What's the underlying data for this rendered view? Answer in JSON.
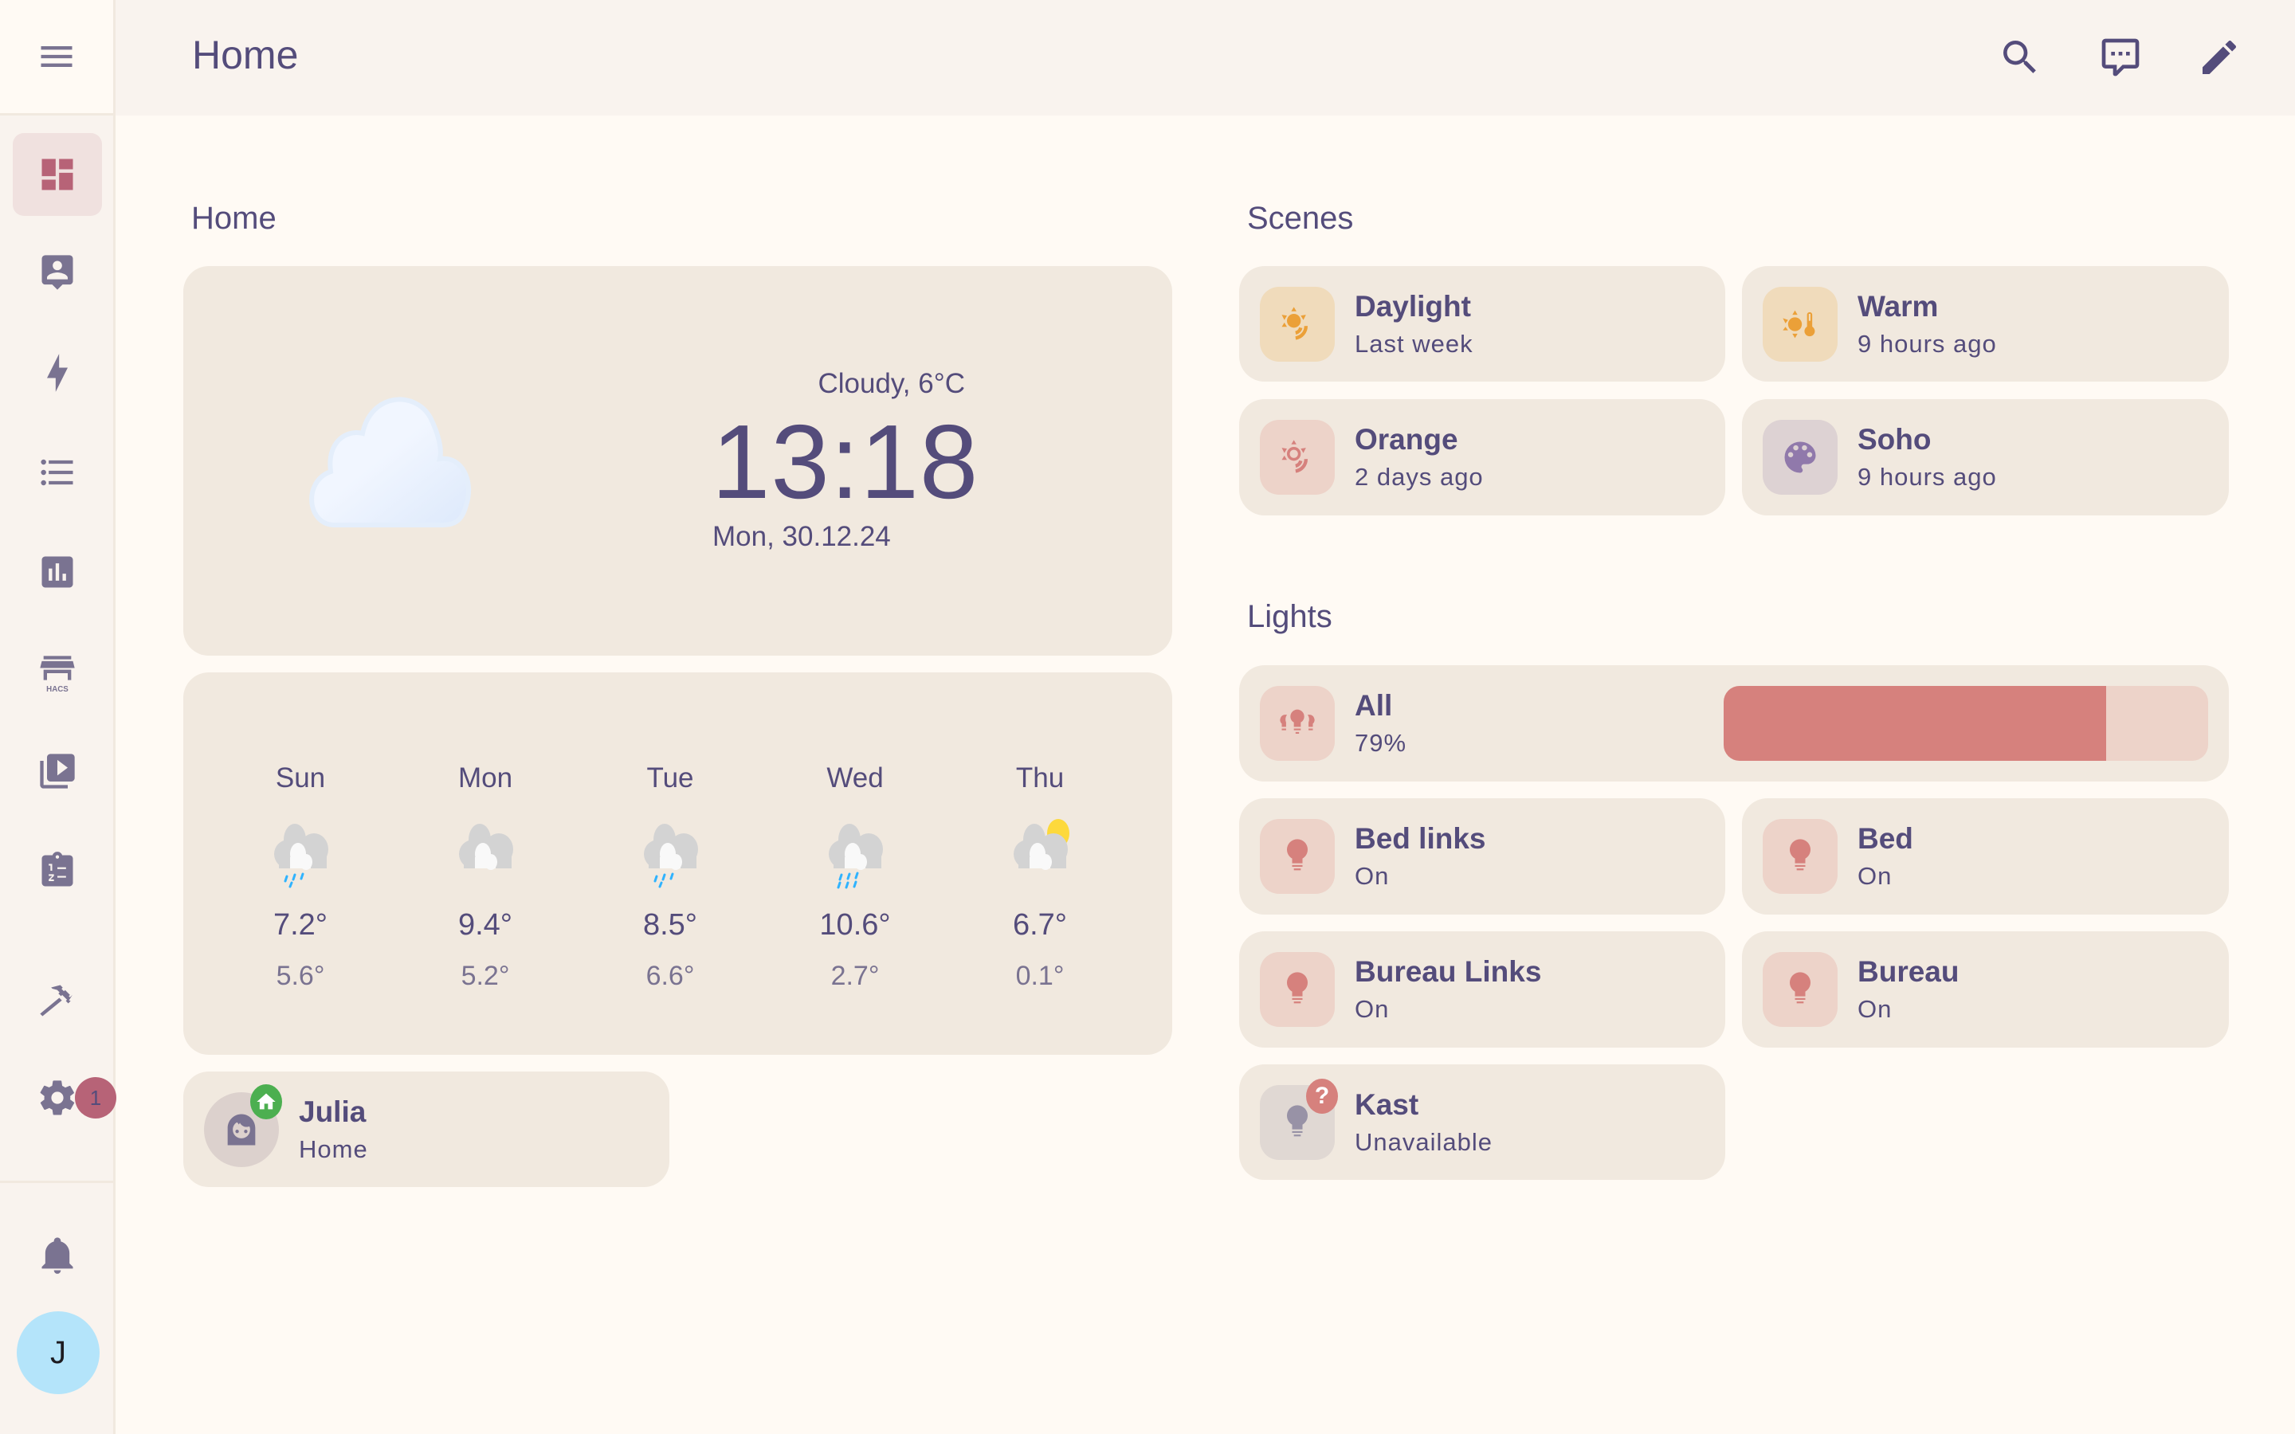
{
  "header": {
    "title": "Home",
    "actions": [
      {
        "name": "search",
        "icon": "search-icon"
      },
      {
        "name": "assist",
        "icon": "chat-icon"
      },
      {
        "name": "edit",
        "icon": "pencil-icon"
      }
    ]
  },
  "sidebar": {
    "menu_icon": "menu-icon",
    "items": [
      {
        "id": "overview",
        "icon": "dashboard-icon",
        "active": true
      },
      {
        "id": "map",
        "icon": "account-box-icon"
      },
      {
        "id": "energy",
        "icon": "lightning-icon"
      },
      {
        "id": "logbook",
        "icon": "format-list-icon"
      },
      {
        "id": "history",
        "icon": "chart-box-icon"
      },
      {
        "id": "hacs",
        "icon": "hacs-store-icon",
        "label": "HACS"
      },
      {
        "id": "media",
        "icon": "play-box-multiple-icon"
      },
      {
        "id": "todo",
        "icon": "clipboard-list-icon"
      },
      {
        "id": "developer-tools",
        "icon": "hammer-icon"
      },
      {
        "id": "settings",
        "icon": "gear-icon",
        "badge": "1"
      }
    ],
    "notifications_icon": "bell-icon",
    "user_initial": "J"
  },
  "colors": {
    "accent": "#b76377",
    "text": "#544c7b",
    "card": "#f1e9df",
    "light_on": "#d6817d",
    "scene_orange": "#eba038",
    "scene_purple": "#9079ab",
    "home_green": "#4caf50",
    "avatar_bg": "#b4e4fa"
  },
  "home_section": {
    "title": "Home",
    "weather": {
      "icon": "cloudy-icon",
      "condition": "Cloudy, 6°C",
      "time": "13:18",
      "date": "Mon, 30.12.24"
    },
    "forecast": [
      {
        "day": "Sun",
        "icon": "rainy-icon",
        "high": "7.2°",
        "low": "5.6°"
      },
      {
        "day": "Mon",
        "icon": "cloudy-icon",
        "high": "9.4°",
        "low": "5.2°"
      },
      {
        "day": "Tue",
        "icon": "rainy-icon",
        "high": "8.5°",
        "low": "6.6°"
      },
      {
        "day": "Wed",
        "icon": "pouring-icon",
        "high": "10.6°",
        "low": "2.7°"
      },
      {
        "day": "Thu",
        "icon": "partly-cloudy-icon",
        "high": "6.7°",
        "low": "0.1°"
      }
    ],
    "person": {
      "name": "Julia",
      "state": "Home"
    }
  },
  "scenes_section": {
    "title": "Scenes",
    "items": [
      {
        "name": "Daylight",
        "state": "Last week",
        "icon": "sun-wireless-icon"
      },
      {
        "name": "Warm",
        "state": "9 hours ago",
        "icon": "sun-thermometer-icon"
      },
      {
        "name": "Orange",
        "state": "2 days ago",
        "icon": "sun-wireless-outline-icon"
      },
      {
        "name": "Soho",
        "state": "9 hours ago",
        "icon": "palette-icon"
      }
    ]
  },
  "lights_section": {
    "title": "Lights",
    "all": {
      "name": "All",
      "state": "79%",
      "brightness": 0.79
    },
    "items": [
      {
        "name": "Bed links",
        "state": "On"
      },
      {
        "name": "Bed",
        "state": "On"
      },
      {
        "name": "Bureau Links",
        "state": "On"
      },
      {
        "name": "Bureau",
        "state": "On"
      },
      {
        "name": "Kast",
        "state": "Unavailable",
        "badge": "?"
      }
    ]
  }
}
